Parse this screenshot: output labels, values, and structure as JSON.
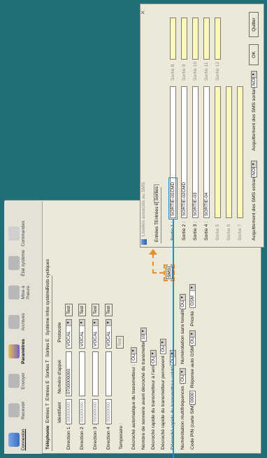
{
  "sidebar": {
    "items": [
      {
        "label": "Connexion",
        "icon": "computer-icon"
      },
      {
        "label": "Recevoir",
        "icon": "receive-icon"
      },
      {
        "label": "Envoyer",
        "icon": "send-icon"
      },
      {
        "label": "Paramètres",
        "icon": "settings-icon"
      },
      {
        "label": "Archives",
        "icon": "archive-icon"
      },
      {
        "label": "Mise à l'heure",
        "icon": "clock-icon"
      },
      {
        "label": "État système",
        "icon": "status-icon"
      },
      {
        "label": "Commandes",
        "icon": "commands-icon"
      }
    ]
  },
  "main": {
    "tabs": [
      "Téléphonie",
      "Entrées T",
      "Entrées E",
      "Sorties T",
      "Sorties E",
      "Système",
      "Infos système",
      "Tests cycliques"
    ],
    "headers": {
      "identifiant": "Identifiant",
      "numero": "Numéro d'appel",
      "protocole": "Protocole"
    },
    "directions": [
      {
        "label": "Direction 1 :",
        "id": "00000000",
        "number": "0700000000",
        "protocol": "VOCAL",
        "test": "Test"
      },
      {
        "label": "Direction 2 :",
        "id": "00000000",
        "number": "",
        "protocol": "VOCAL",
        "test": "Test"
      },
      {
        "label": "Direction 3 :",
        "id": "00000000",
        "number": "",
        "protocol": "VOCAL",
        "test": "Test"
      },
      {
        "label": "Direction 4 :",
        "id": "00000000",
        "number": "",
        "protocol": "VOCAL",
        "test": "Test"
      }
    ],
    "temporaire_label": "Temporaire :",
    "temporaire_test": "Test",
    "options": [
      {
        "label": "Décroché automatique du transmetteur :",
        "value": "OUI"
      },
      {
        "label": "Nombre de sonnerie avant décroché du transmetteur :",
        "value": "10"
      },
      {
        "label": "Décroché rapide du transmetteur à l'arrêt :",
        "value": "OUI"
      },
      {
        "label": "Décroché rapide du transmetteur permanent :",
        "value": "OUI"
      },
      {
        "label": "Décroché rapide du transmetteur validé :",
        "value": "OUI"
      }
    ],
    "numerotation_multi_label": "Numérotation multifréquences :",
    "numerotation_multi_value": "OUI",
    "numerotation_tonalite_label": "Numérotation sans tonalité :",
    "numerotation_tonalite_value": "OUI",
    "pin_label": "Code PIN (carte SIM) :",
    "pin_value": "0000",
    "reponse_gsm_label": "Réponse auto GSM :",
    "reponse_gsm_value": "OUI",
    "priorite_label": "Priorité :",
    "priorite_value": "GSM",
    "sms_button": "SMS"
  },
  "dialog": {
    "title": "Libellés associés au SMS",
    "tabs": [
      "Entrées T",
      "Entrées E",
      "Sorties"
    ],
    "sorties": [
      {
        "label": "Sortie 1 :",
        "value": "SORTIE-01CMD"
      },
      {
        "label": "Sortie 2 :",
        "value": "SORTIE-02CMD"
      },
      {
        "label": "Sortie 3 :",
        "value": "SORTIE-03"
      },
      {
        "label": "Sortie 4 :",
        "value": "SORTIE-04"
      },
      {
        "label": "Sortie 5",
        "value": ""
      },
      {
        "label": "Sortie 6",
        "value": ""
      },
      {
        "label": "Sortie 7",
        "value": ""
      },
      {
        "label": "Sortie 8",
        "value": ""
      },
      {
        "label": "Sortie 9",
        "value": ""
      },
      {
        "label": "Sortie 10",
        "value": ""
      },
      {
        "label": "Sortie 11",
        "value": ""
      },
      {
        "label": "Sortie 12",
        "value": ""
      }
    ],
    "ack_in_label": "Acquittement des SMS entrants",
    "ack_in_value": "NON",
    "ack_out_label": "Acquittement des SMS sortants",
    "ack_out_value": "NON",
    "ok_label": "OK",
    "quit_label": "Quitter",
    "close_glyph": "×"
  },
  "colors": {
    "background": "#1f6f78",
    "window": "#ece9d8",
    "highlight": "#f08a24",
    "callout": "#1e8bd6",
    "yellow_field": "#fdf8b8"
  }
}
